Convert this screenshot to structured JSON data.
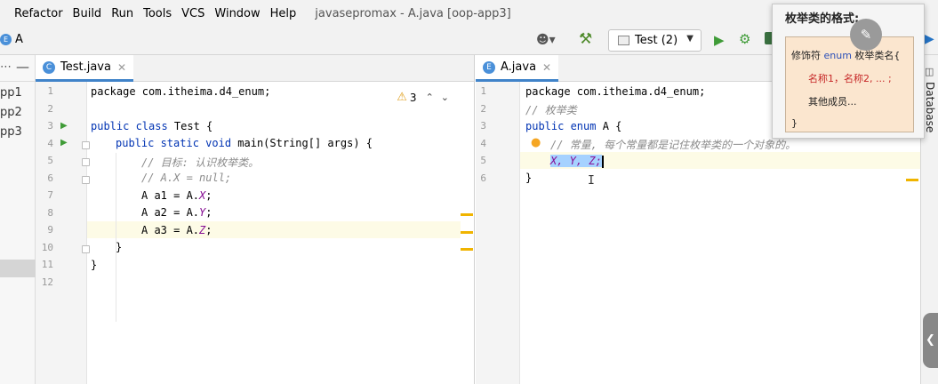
{
  "menu": {
    "items": [
      "Refactor",
      "Build",
      "Run",
      "Tools",
      "VCS",
      "Window",
      "Help"
    ],
    "window_title": "javasepromax - A.java [oop-app3]"
  },
  "toolbar": {
    "nav_label": "A",
    "run_config": "Test (2)"
  },
  "project": {
    "items": [
      "pp1",
      "pp2",
      "pp3"
    ]
  },
  "left_editor": {
    "tab": "Test.java",
    "warnings": "3",
    "line_numbers": [
      "1",
      "2",
      "3",
      "4",
      "5",
      "6",
      "7",
      "8",
      "9",
      "10",
      "11",
      "12"
    ],
    "lines": {
      "l1": "package com.itheima.d4_enum;",
      "l3_kw": "public class",
      "l3_rest": " Test {",
      "l4_kw": "public static void",
      "l4_rest": " main(String[] args) {",
      "l5": "// 目标: 认识枚举类。",
      "l6": "// A.X = null;",
      "l7_pre": "A a1 = A.",
      "l7_fld": "X",
      "l8_pre": "A a2 = A.",
      "l8_fld": "Y",
      "l9_pre": "A a3 = A.",
      "l9_fld": "Z",
      "semicolon": ";",
      "l10": "}",
      "l11": "}"
    }
  },
  "right_editor": {
    "tab": "A.java",
    "line_numbers": [
      "1",
      "2",
      "3",
      "4",
      "5",
      "6"
    ],
    "lines": {
      "l1": "package com.itheima.d4_enum;",
      "l2": "// 枚举类",
      "l3_kw": "public enum",
      "l3_rest": " A {",
      "l4": "// 常量, 每个常量都是记住枚举类的一个对象的。",
      "l5": "X, Y, Z;",
      "l6": "}"
    }
  },
  "side": {
    "database_label": "Database"
  },
  "popup": {
    "title": "枚举类的格式:",
    "line1_pre": "修饰符 ",
    "line1_kw": "enum",
    "line1_post": " 枚举类名{",
    "line2": "名称1，名称2, ... ;",
    "line3": "其他成员...",
    "line4": "}"
  },
  "colors": {
    "keyword": "#0033b3",
    "comment": "#8c8c8c",
    "field": "#871094",
    "selection": "#a6d2ff",
    "accent": "#4083c9"
  }
}
